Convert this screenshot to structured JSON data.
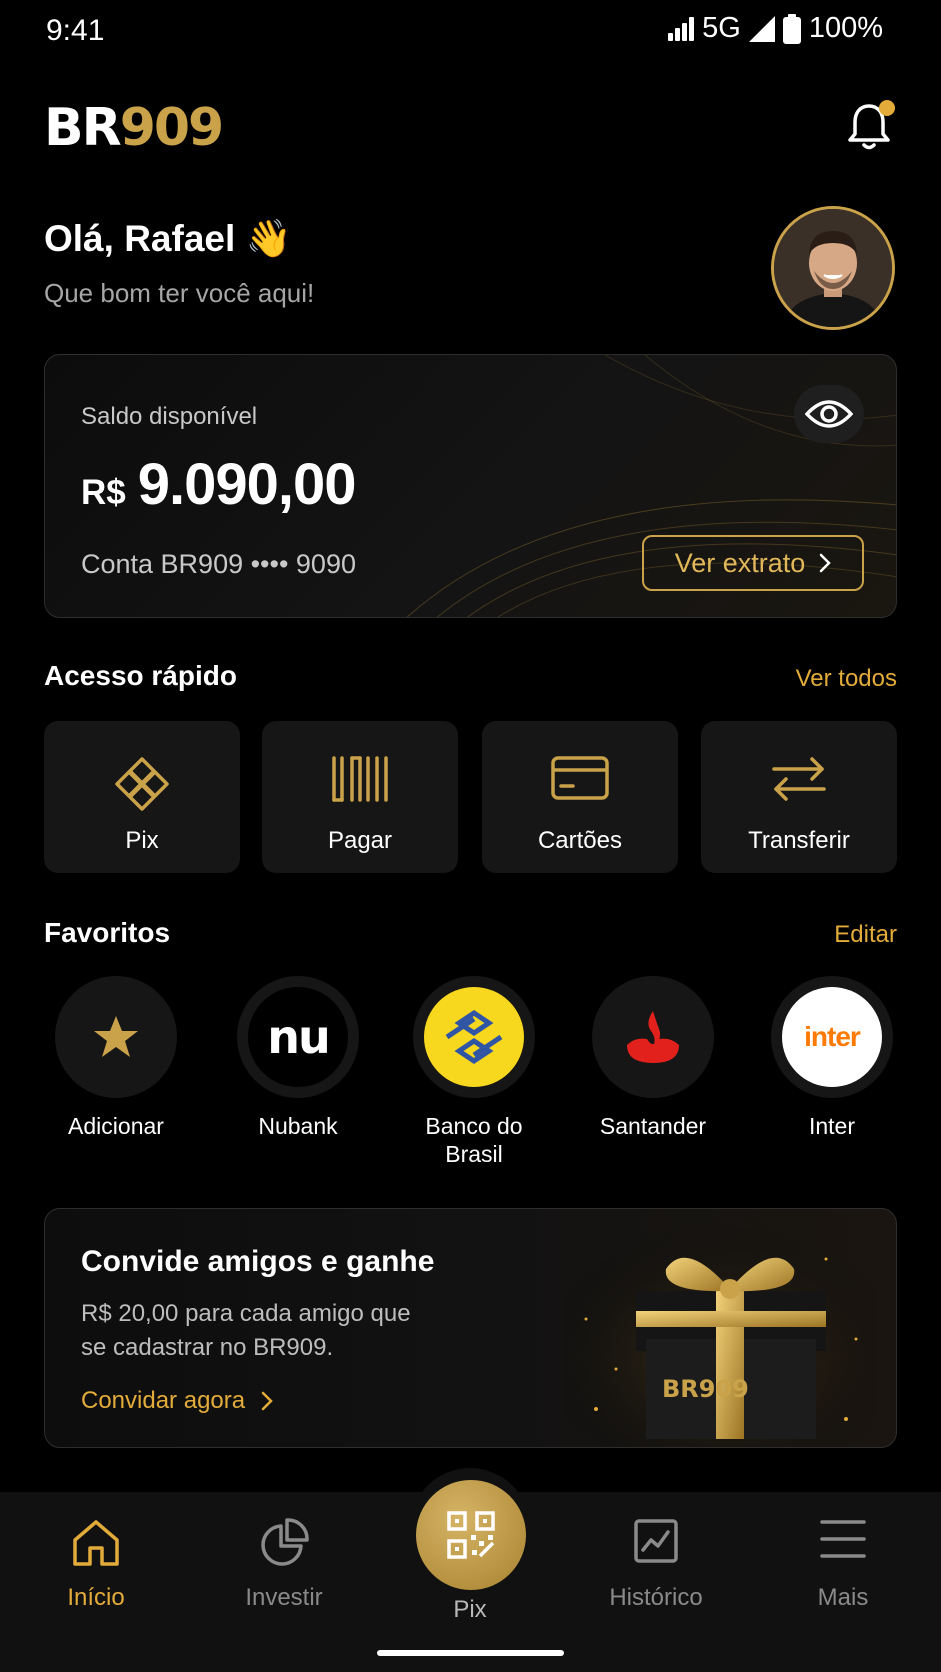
{
  "status": {
    "time": "9:41",
    "network": "5G",
    "battery": "100%"
  },
  "header": {
    "logo_br": "BR",
    "logo_num": "909"
  },
  "greeting": {
    "title": "Olá, Rafael 👋",
    "subtitle": "Que bom ter você aqui!"
  },
  "balance": {
    "label": "Saldo disponível",
    "currency": "R$",
    "amount": "9.090,00",
    "account": "Conta BR909 •••• 9090",
    "extract_label": "Ver extrato"
  },
  "quick_access": {
    "title": "Acesso rápido",
    "link": "Ver todos",
    "items": [
      {
        "label": "Pix",
        "icon": "pix-icon"
      },
      {
        "label": "Pagar",
        "icon": "barcode-icon"
      },
      {
        "label": "Cartões",
        "icon": "card-icon"
      },
      {
        "label": "Transferir",
        "icon": "transfer-icon"
      }
    ]
  },
  "favorites": {
    "title": "Favoritos",
    "link": "Editar",
    "items": [
      {
        "label": "Adicionar"
      },
      {
        "label": "Nubank",
        "logo_text": "nu"
      },
      {
        "label": "Banco do Brasil"
      },
      {
        "label": "Santander"
      },
      {
        "label": "Inter",
        "logo_text": "inter"
      }
    ]
  },
  "invite": {
    "title": "Convide amigos e ganhe",
    "text": "R$ 20,00 para cada amigo que se cadastrar no BR909.",
    "link": "Convidar agora",
    "gift_text": "BR909"
  },
  "nav": {
    "items": [
      {
        "label": "Início",
        "icon": "home-icon",
        "active": true
      },
      {
        "label": "Investir",
        "icon": "pie-chart-icon"
      },
      {
        "label": "Pix",
        "icon": "qr-code-icon"
      },
      {
        "label": "Histórico",
        "icon": "chart-icon"
      },
      {
        "label": "Mais",
        "icon": "menu-icon"
      }
    ]
  },
  "colors": {
    "accent": "#e3ac3a",
    "gold": "#c9a24a",
    "background": "#000000",
    "tile": "#161616"
  }
}
